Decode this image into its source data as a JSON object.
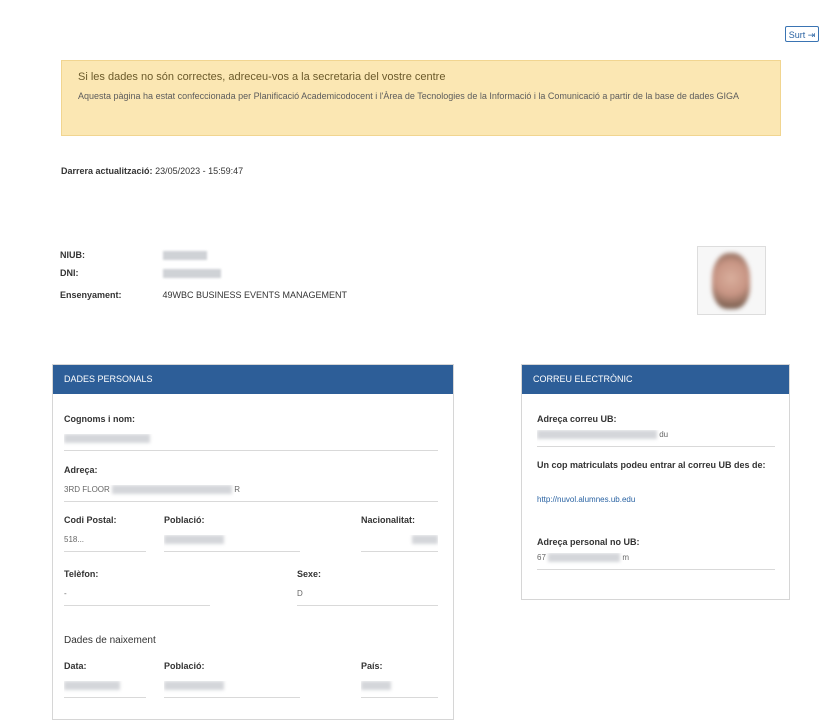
{
  "header": {
    "logout_label": "Surt"
  },
  "alert": {
    "title": "Si les dades no són correctes, adreceu-vos a la secretaria del vostre centre",
    "body": "Aquesta pàgina ha estat confeccionada per Planificació Academicodocent i l'Àrea de Tecnologies de la Informació i la Comunicació a partir de la base de dades GIGA"
  },
  "last_update": {
    "label": "Darrera actualització:",
    "value": "23/05/2023 - 15:59:47"
  },
  "student": {
    "niub_label": "NIUB:",
    "dni_label": "DNI:",
    "ensenyament_label": "Ensenyament:",
    "ensenyament_value": "49WBC BUSINESS EVENTS MANAGEMENT"
  },
  "personal": {
    "header": "DADES PERSONALS",
    "name_label": "Cognoms i nom:",
    "address_label": "Adreça:",
    "address_value": "3RD FLOOR",
    "address_suffix": "R",
    "postal_label": "Codi Postal:",
    "postal_value": "518...",
    "city_label": "Població:",
    "nationality_label": "Nacionalitat:",
    "phone_label": "Telèfon:",
    "phone_value": "-",
    "sex_label": "Sexe:",
    "sex_value": "D",
    "birth_title": "Dades de naixement",
    "birth_date_label": "Data:",
    "birth_city_label": "Població:",
    "birth_country_label": "País:"
  },
  "email": {
    "header": "CORREU ELECTRÒNIC",
    "ub_label": "Adreça correu UB:",
    "ub_value_suffix": "du",
    "info_text": "Un cop matriculats podeu entrar al correu UB des de:",
    "link": "http://nuvol.alumnes.ub.edu",
    "personal_label": "Adreça personal no UB:",
    "personal_prefix": "67",
    "personal_suffix": "m"
  },
  "colors": {
    "panel_header": "#2d5e98",
    "alert_bg": "#fbe7b3",
    "link": "#2a63a3"
  }
}
